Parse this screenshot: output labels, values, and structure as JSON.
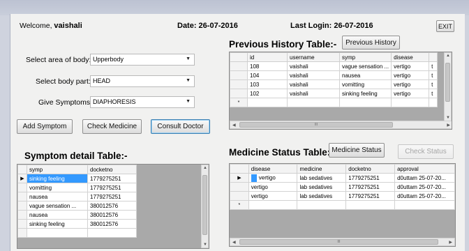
{
  "header": {
    "welcome_label": "Welcome,",
    "username": "vaishali",
    "date": "Date: 26-07-2016",
    "last_login": "Last Login: 26-07-2016",
    "exit_label": "EXIT"
  },
  "form": {
    "area_label": "Select area of body:",
    "area_value": "Upperbody",
    "part_label": "Select body part:",
    "part_value": "HEAD",
    "symptom_label": "Give Symptoms:",
    "symptom_value": "DIAPHORESIS"
  },
  "buttons": {
    "add_symptom": "Add Symptom",
    "check_medicine": "Check Medicine",
    "consult_doctor": "Consult Doctor",
    "previous_history": "Previous History",
    "medicine_status": "Medicine Status",
    "check_status": "Check Status"
  },
  "history": {
    "title": "Previous History Table:-",
    "columns": [
      "id",
      "username",
      "symp",
      "disease"
    ],
    "rows": [
      [
        "108",
        "vaishali",
        "vague sensation ...",
        "vertigo"
      ],
      [
        "104",
        "vaishali",
        "nausea",
        "vertigo"
      ],
      [
        "103",
        "vaishali",
        "vomitting",
        "vertigo"
      ],
      [
        "102",
        "vaishali",
        "sinking feeling",
        "vertigo"
      ]
    ],
    "cut_text": "t"
  },
  "symptom_table": {
    "title": "Symptom detail Table:-",
    "columns": [
      "symp",
      "docketno"
    ],
    "rows": [
      [
        "sinking feeling",
        "1779275251"
      ],
      [
        "vomitting",
        "1779275251"
      ],
      [
        "nausea",
        "1779275251"
      ],
      [
        "vague sensation ...",
        "380012576"
      ],
      [
        "nausea",
        "380012576"
      ],
      [
        "sinking feeling",
        "380012576"
      ]
    ]
  },
  "medicine_table": {
    "title": "Medicine Status Table:-",
    "columns": [
      "disease",
      "medicine",
      "docketno",
      "approval"
    ],
    "rows": [
      [
        "vertigo",
        "lab sedatives",
        "1779275251",
        "d0uttam 25-07-20..."
      ],
      [
        "vertigo",
        "lab sedatives",
        "1779275251",
        "d0uttam 25-07-20..."
      ],
      [
        "vertigo",
        "lab sedatives",
        "1779275251",
        "d0uttam 25-07-20..."
      ]
    ]
  },
  "glyphs": {
    "row_pointer": "▶",
    "new_row": "*",
    "combo_arrow": "▼",
    "up": "▲",
    "down": "▼",
    "left": "◀",
    "right": "▶",
    "grip": "III"
  },
  "icons": [
    "combo-arrow-icon",
    "row-pointer-icon",
    "new-row-icon",
    "scroll-arrow-icon"
  ]
}
